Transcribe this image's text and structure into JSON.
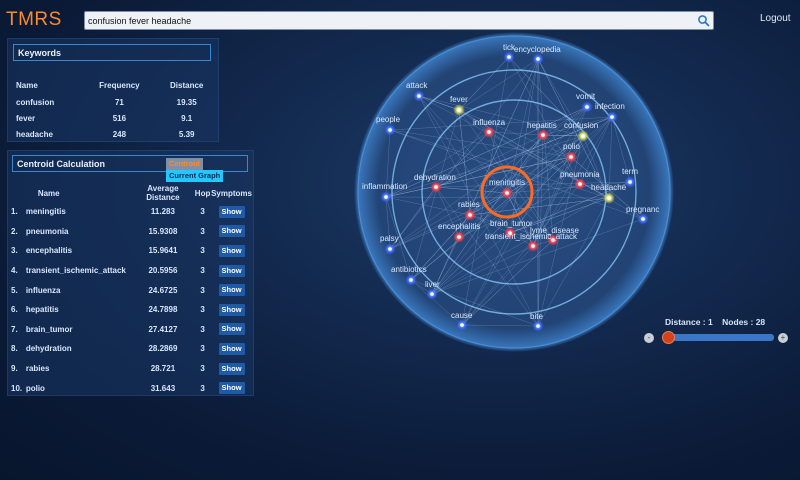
{
  "header": {
    "logo": "TMRS",
    "search_value": "confusion fever headache",
    "logout_label": "Logout"
  },
  "keywords": {
    "title": "Keywords",
    "columns": [
      "Name",
      "Frequency",
      "Distance"
    ],
    "rows": [
      {
        "name": "confusion",
        "frequency": "71",
        "distance": "19.35"
      },
      {
        "name": "fever",
        "frequency": "516",
        "distance": "9.1"
      },
      {
        "name": "headache",
        "frequency": "248",
        "distance": "5.39"
      }
    ]
  },
  "centroid": {
    "title": "Centroid Calculation",
    "tabs": [
      "Centroid",
      "Current Graph"
    ],
    "columns": [
      "Name",
      "Average Distance",
      "Hop",
      "Symptoms"
    ],
    "show_label": "Show",
    "rows": [
      {
        "num": "1.",
        "name": "meningitis",
        "avg": "11.283",
        "hop": "3"
      },
      {
        "num": "2.",
        "name": "pneumonia",
        "avg": "15.9308",
        "hop": "3"
      },
      {
        "num": "3.",
        "name": "encephalitis",
        "avg": "15.9641",
        "hop": "3"
      },
      {
        "num": "4.",
        "name": "transient_ischemic_attack",
        "avg": "20.5956",
        "hop": "3"
      },
      {
        "num": "5.",
        "name": "influenza",
        "avg": "24.6725",
        "hop": "3"
      },
      {
        "num": "6.",
        "name": "hepatitis",
        "avg": "24.7898",
        "hop": "3"
      },
      {
        "num": "7.",
        "name": "brain_tumor",
        "avg": "27.4127",
        "hop": "3"
      },
      {
        "num": "8.",
        "name": "dehydration",
        "avg": "28.2869",
        "hop": "3"
      },
      {
        "num": "9.",
        "name": "rabies",
        "avg": "28.721",
        "hop": "3"
      },
      {
        "num": "10.",
        "name": "polio",
        "avg": "31.643",
        "hop": "3"
      }
    ]
  },
  "graph": {
    "center": "meningitis",
    "inner_nodes": [
      "influenza",
      "hepatitis",
      "polio",
      "dehydration",
      "pneumonia",
      "rabies",
      "brain_tumor",
      "encephalitis",
      "lyme_disease",
      "transient_ischemic_attack"
    ],
    "keyword_nodes": [
      "fever",
      "confusion",
      "headache"
    ],
    "outer_nodes": [
      "tick",
      "encyclopedia",
      "attack",
      "vomit",
      "infection",
      "people",
      "inflammation",
      "term",
      "pregnancy",
      "palsy",
      "antibiotics",
      "liver",
      "cause",
      "bite"
    ],
    "colors": {
      "disease": "#ff3340",
      "keyword": "#d8e060",
      "term": "#2f6bff",
      "focus_ring": "#ff6a1e",
      "ring": "#6fb0e6"
    }
  },
  "slider": {
    "distance_label": "Distance : 1",
    "nodes_label": "Nodes : 28",
    "minus": "-",
    "plus": "+",
    "value_fraction": 0.0
  }
}
